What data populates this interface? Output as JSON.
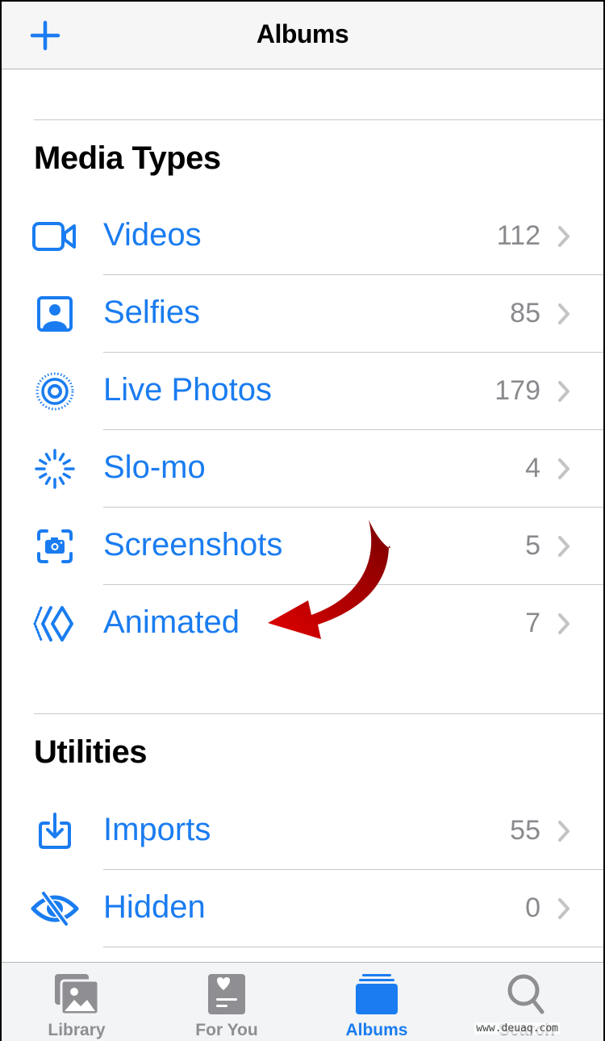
{
  "header": {
    "title": "Albums",
    "add_icon": "plus-icon"
  },
  "sections": [
    {
      "title": "Media Types",
      "items": [
        {
          "label": "Videos",
          "count": "112",
          "icon": "video-camera-icon"
        },
        {
          "label": "Selfies",
          "count": "85",
          "icon": "selfie-portrait-icon"
        },
        {
          "label": "Live Photos",
          "count": "179",
          "icon": "live-photo-icon"
        },
        {
          "label": "Slo-mo",
          "count": "4",
          "icon": "slo-mo-icon"
        },
        {
          "label": "Screenshots",
          "count": "5",
          "icon": "screenshot-icon"
        },
        {
          "label": "Animated",
          "count": "7",
          "icon": "animated-icon"
        }
      ]
    },
    {
      "title": "Utilities",
      "items": [
        {
          "label": "Imports",
          "count": "55",
          "icon": "import-icon"
        },
        {
          "label": "Hidden",
          "count": "0",
          "icon": "eye-slash-icon"
        }
      ]
    }
  ],
  "tabbar": {
    "tabs": [
      {
        "label": "Library",
        "icon": "library-icon",
        "active": false
      },
      {
        "label": "For You",
        "icon": "for-you-icon",
        "active": false
      },
      {
        "label": "Albums",
        "icon": "albums-icon",
        "active": true
      },
      {
        "label": "Search",
        "icon": "search-icon",
        "active": false
      }
    ]
  },
  "annotation": {
    "type": "red-arrow",
    "points_to": "Animated"
  },
  "watermark": "www.deuaq.com",
  "colors": {
    "accent": "#1a7cf0",
    "count": "#8a8a8e",
    "chevron": "#c4c4c6",
    "inactive_tab": "#8e8e93",
    "arrow": "#c40000"
  }
}
